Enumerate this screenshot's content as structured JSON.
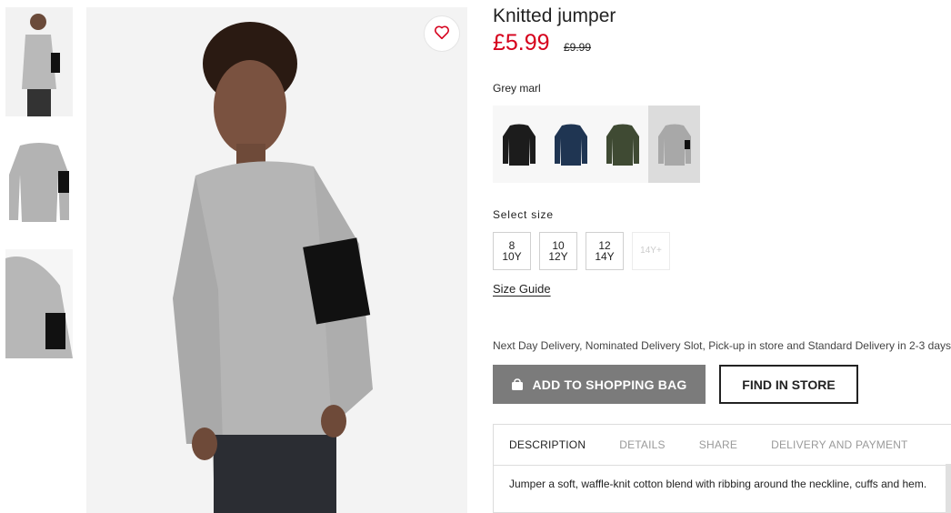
{
  "product": {
    "title": "Knitted jumper",
    "price": "£5.99",
    "old_price": "£9.99",
    "selected_color": "Grey marl"
  },
  "colors": [
    {
      "name": "black",
      "hex": "#1c1c1c"
    },
    {
      "name": "navy",
      "hex": "#1f3552"
    },
    {
      "name": "khaki green",
      "hex": "#3f4a33"
    },
    {
      "name": "grey marl",
      "hex": "#a8a8a8",
      "selected": true
    }
  ],
  "sizes": {
    "label": "Select size",
    "options": [
      {
        "line1": "8",
        "line2": "10Y"
      },
      {
        "line1": "10",
        "line2": "12Y"
      },
      {
        "line1": "12",
        "line2": "14Y"
      },
      {
        "line1": "14Y+",
        "line2": "",
        "disabled": true
      }
    ],
    "guide": "Size Guide"
  },
  "delivery_text": "Next Day Delivery, Nominated Delivery Slot, Pick-up in store and Standard Delivery in 2-3 days.",
  "buttons": {
    "add_to_bag": "ADD TO SHOPPING BAG",
    "find_in_store": "FIND IN STORE"
  },
  "tabs": [
    {
      "label": "DESCRIPTION",
      "active": true
    },
    {
      "label": "DETAILS"
    },
    {
      "label": "SHARE"
    },
    {
      "label": "DELIVERY AND PAYMENT"
    }
  ],
  "description": "Jumper a soft, waffle-knit cotton blend with ribbing around the neckline, cuffs and hem.",
  "icons": {
    "favorite": "heart-icon",
    "bag": "shopping-bag-icon"
  },
  "accent_color": "#d6001c"
}
